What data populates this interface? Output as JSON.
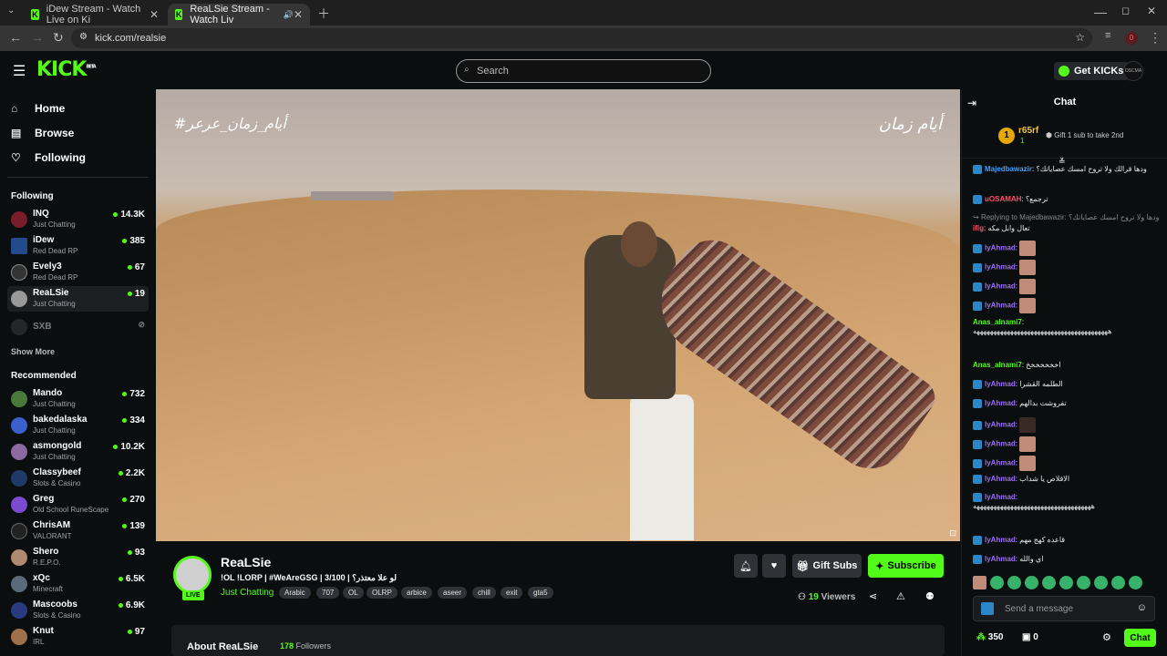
{
  "browser": {
    "tabs": [
      {
        "title": "iDew Stream - Watch Live on Ki",
        "active": false
      },
      {
        "title": "ReaLSie Stream - Watch Liv",
        "active": true
      }
    ],
    "url": "kick.com/realsie",
    "badge_count": "0"
  },
  "header": {
    "logo": "KICK",
    "logo_beta": "BETA",
    "search_placeholder": "Search",
    "get_kicks": "Get KICKs",
    "avatar_text": "OSCMA"
  },
  "sidebar": {
    "nav": [
      {
        "label": "Home",
        "icon": "home-icon"
      },
      {
        "label": "Browse",
        "icon": "browse-icon"
      },
      {
        "label": "Following",
        "icon": "heart-icon"
      }
    ],
    "following_title": "Following",
    "following": [
      {
        "name": "INQ",
        "category": "Just Chatting",
        "viewers": "14.3K"
      },
      {
        "name": "iDew",
        "category": "Red Dead RP",
        "viewers": "385"
      },
      {
        "name": "Evely3",
        "category": "Red Dead RP",
        "viewers": "67"
      },
      {
        "name": "ReaLSie",
        "category": "Just Chatting",
        "viewers": "19"
      },
      {
        "name": "SXB",
        "category": "",
        "viewers": ""
      }
    ],
    "show_more": "Show More",
    "recommended_title": "Recommended",
    "recommended": [
      {
        "name": "Mando",
        "category": "Just Chatting",
        "viewers": "732"
      },
      {
        "name": "bakedalaska",
        "category": "Just Chatting",
        "viewers": "334"
      },
      {
        "name": "asmongold",
        "category": "Just Chatting",
        "viewers": "10.2K"
      },
      {
        "name": "Classybeef",
        "category": "Slots & Casino",
        "viewers": "2.2K"
      },
      {
        "name": "Greg",
        "category": "Old School RuneScape",
        "viewers": "270"
      },
      {
        "name": "ChrisAM",
        "category": "VALORANT",
        "viewers": "139"
      },
      {
        "name": "Shero",
        "category": "R.E.P.O.",
        "viewers": "93"
      },
      {
        "name": "xQc",
        "category": "Minecraft",
        "viewers": "6.5K"
      },
      {
        "name": "Mascoobs",
        "category": "Slots & Casino",
        "viewers": "6.9K"
      },
      {
        "name": "Knut",
        "category": "IRL",
        "viewers": "97"
      }
    ]
  },
  "video": {
    "watermark_left": "#أيام_زمان_عرعر",
    "watermark_right": "أيام زمان"
  },
  "stream": {
    "name": "ReaLSie",
    "live": "LIVE",
    "title": "!OL !LORP | #WeAreGSG | 3/100 | لو علا معتذر؟",
    "category": "Just Chatting",
    "tags": [
      "Arabic",
      "707",
      "OL",
      "OLRP",
      "arbice",
      "aseer",
      "chill",
      "exit",
      "gta5"
    ],
    "gift_subs": "Gift Subs",
    "subscribe": "Subscribe",
    "viewers_count": "19",
    "viewers_label": "Viewers",
    "about_title": "About ReaLSie",
    "followers_count": "178",
    "followers_label": "Followers"
  },
  "chat": {
    "title": "Chat",
    "pinned_rank": "1",
    "pinned_user": "r65rf",
    "pinned_count": "1",
    "pinned_text": "Gift 1 sub to take 2nd",
    "messages": [
      {
        "user": "Majedbawazir",
        "color": "#3fa0ff",
        "text": "ودها قرالك ولا تروح امسك عصاياتك؟"
      },
      {
        "user": "uOSAMAH",
        "color": "#ff4d6a",
        "text": "ترجمع؟"
      },
      {
        "user": "Replying to Majedbawazir:",
        "color": "#888888",
        "text": "ودها ولا تروح امسك عصاياتك؟"
      },
      {
        "user": "iflg",
        "color": "#ff4d6a",
        "text": "تعال وابل مكه"
      },
      {
        "user": "lyAhmad",
        "color": "#9c6bff",
        "text": ""
      },
      {
        "user": "lyAhmad",
        "color": "#9c6bff",
        "text": ""
      },
      {
        "user": "lyAhmad",
        "color": "#9c6bff",
        "text": ""
      },
      {
        "user": "lyAhmad",
        "color": "#9c6bff",
        "text": ""
      },
      {
        "user": "Anas_alnami7",
        "color": "#53fc18",
        "text": "ههههههههههههههههههههههههههههههههههههههههه"
      },
      {
        "user": "Anas_alnami7",
        "color": "#53fc18",
        "text": "اخخخخخخخ"
      },
      {
        "user": "lyAhmad",
        "color": "#9c6bff",
        "text": "الطلمه القشرا"
      },
      {
        "user": "lyAhmad",
        "color": "#9c6bff",
        "text": "تفروشت بدالهم"
      },
      {
        "user": "lyAhmad",
        "color": "#9c6bff",
        "text": ""
      },
      {
        "user": "lyAhmad",
        "color": "#9c6bff",
        "text": ""
      },
      {
        "user": "lyAhmad",
        "color": "#9c6bff",
        "text": ""
      },
      {
        "user": "lyAhmad",
        "color": "#9c6bff",
        "text": "الاقلاص يا شداب"
      },
      {
        "user": "lyAhmad",
        "color": "#9c6bff",
        "text": "هههههههههههههههههههههههههههههههههههه"
      },
      {
        "user": "lyAhmad",
        "color": "#9c6bff",
        "text": "قاعده كهج مهم"
      },
      {
        "user": "lyAhmad",
        "color": "#9c6bff",
        "text": "اي والله"
      }
    ],
    "input_placeholder": "Send a message",
    "kicks_count": "350",
    "gifts_count": "0",
    "chat_button": "Chat"
  },
  "colors": {
    "accent": "#53fc18",
    "bg": "#0b0e0f",
    "panel": "#191b1f"
  }
}
